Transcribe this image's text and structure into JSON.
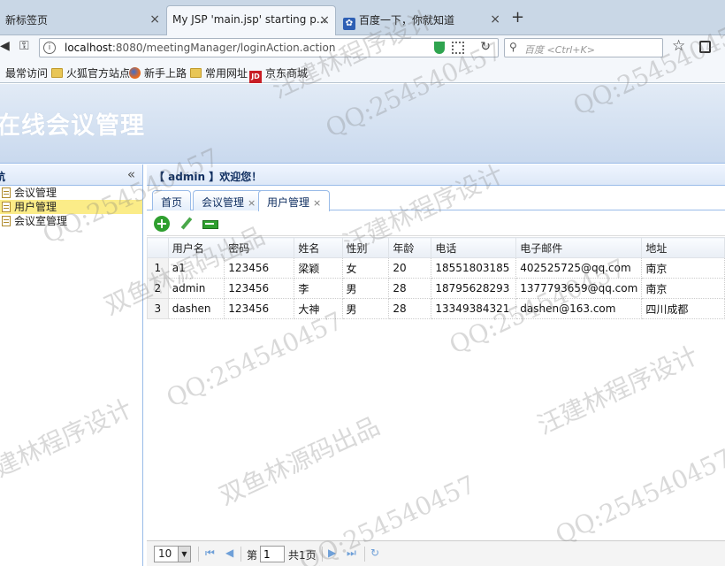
{
  "browser": {
    "tabs": [
      {
        "label": "新标签页"
      },
      {
        "label": "My JSP 'main.jsp' starting p..."
      },
      {
        "label": "百度一下，你就知道"
      }
    ],
    "url_host": "localhost",
    "url_path": ":8080/meetingManager/loginAction.action",
    "search_placeholder": "百度 <Ctrl+K>",
    "bookmarks": [
      "最常访问",
      "火狐官方站点",
      "新手上路",
      "常用网址",
      "京东商城"
    ]
  },
  "app": {
    "title": "在线会议管理",
    "nav_title": "航",
    "nav_items": [
      "会议管理",
      "用户管理",
      "会议室管理"
    ],
    "welcome": "【 admin 】欢迎您！",
    "tabs": [
      "首页",
      "会议管理",
      "用户管理"
    ],
    "table": {
      "columns": [
        "用户名",
        "密码",
        "姓名",
        "性别",
        "年龄",
        "电话",
        "电子邮件",
        "地址"
      ],
      "rows": [
        [
          "1",
          "a1",
          "123456",
          "梁颖",
          "女",
          "20",
          "18551803185",
          "402525725@qq.com",
          "南京"
        ],
        [
          "2",
          "admin",
          "123456",
          "李",
          "男",
          "28",
          "18795628293",
          "1377793659@qq.com",
          "南京"
        ],
        [
          "3",
          "dashen",
          "123456",
          "大神",
          "男",
          "28",
          "13349384321",
          "dashen@163.com",
          "四川成都"
        ]
      ]
    },
    "pager": {
      "page_size": "10",
      "page_label": "第",
      "page_value": "1",
      "total_label": "共1页"
    }
  },
  "watermark": {
    "qq": "QQ:254540457",
    "brand1": "双鱼林源码出品",
    "brand2": "汪建林程序设计"
  }
}
